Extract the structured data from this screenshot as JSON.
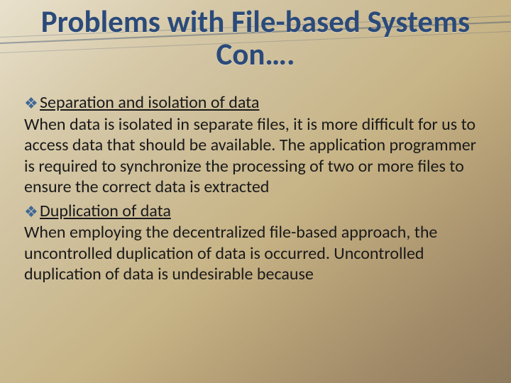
{
  "title": "Problems with File-based Systems Con….",
  "bullets": [
    {
      "label": "Separation and isolation of data"
    },
    {
      "label": "Duplication of data"
    }
  ],
  "paras": [
    "When data is isolated in separate files, it is more difficult for us to access data that should be available. The application programmer is required to synchronize the processing of two or more files to ensure the correct data is extracted",
    "When employing the decentralized file-based approach, the uncontrolled duplication of data is occurred.  Uncontrolled duplication of data is undesirable because"
  ],
  "bullet_glyph": "❖"
}
